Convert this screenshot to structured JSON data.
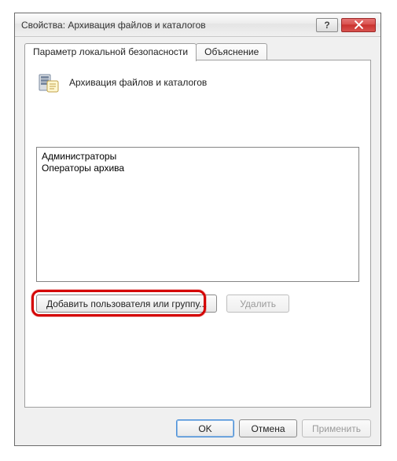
{
  "window": {
    "title": "Свойства: Архивация файлов и каталогов"
  },
  "tabs": {
    "active": "Параметр локальной безопасности",
    "other": "Объяснение"
  },
  "header": {
    "policy_name": "Архивация файлов и каталогов"
  },
  "list": {
    "items": [
      "Администраторы",
      "Операторы архива"
    ]
  },
  "buttons": {
    "add": "Добавить пользователя или группу...",
    "remove": "Удалить",
    "ok": "OK",
    "cancel": "Отмена",
    "apply": "Применить"
  }
}
